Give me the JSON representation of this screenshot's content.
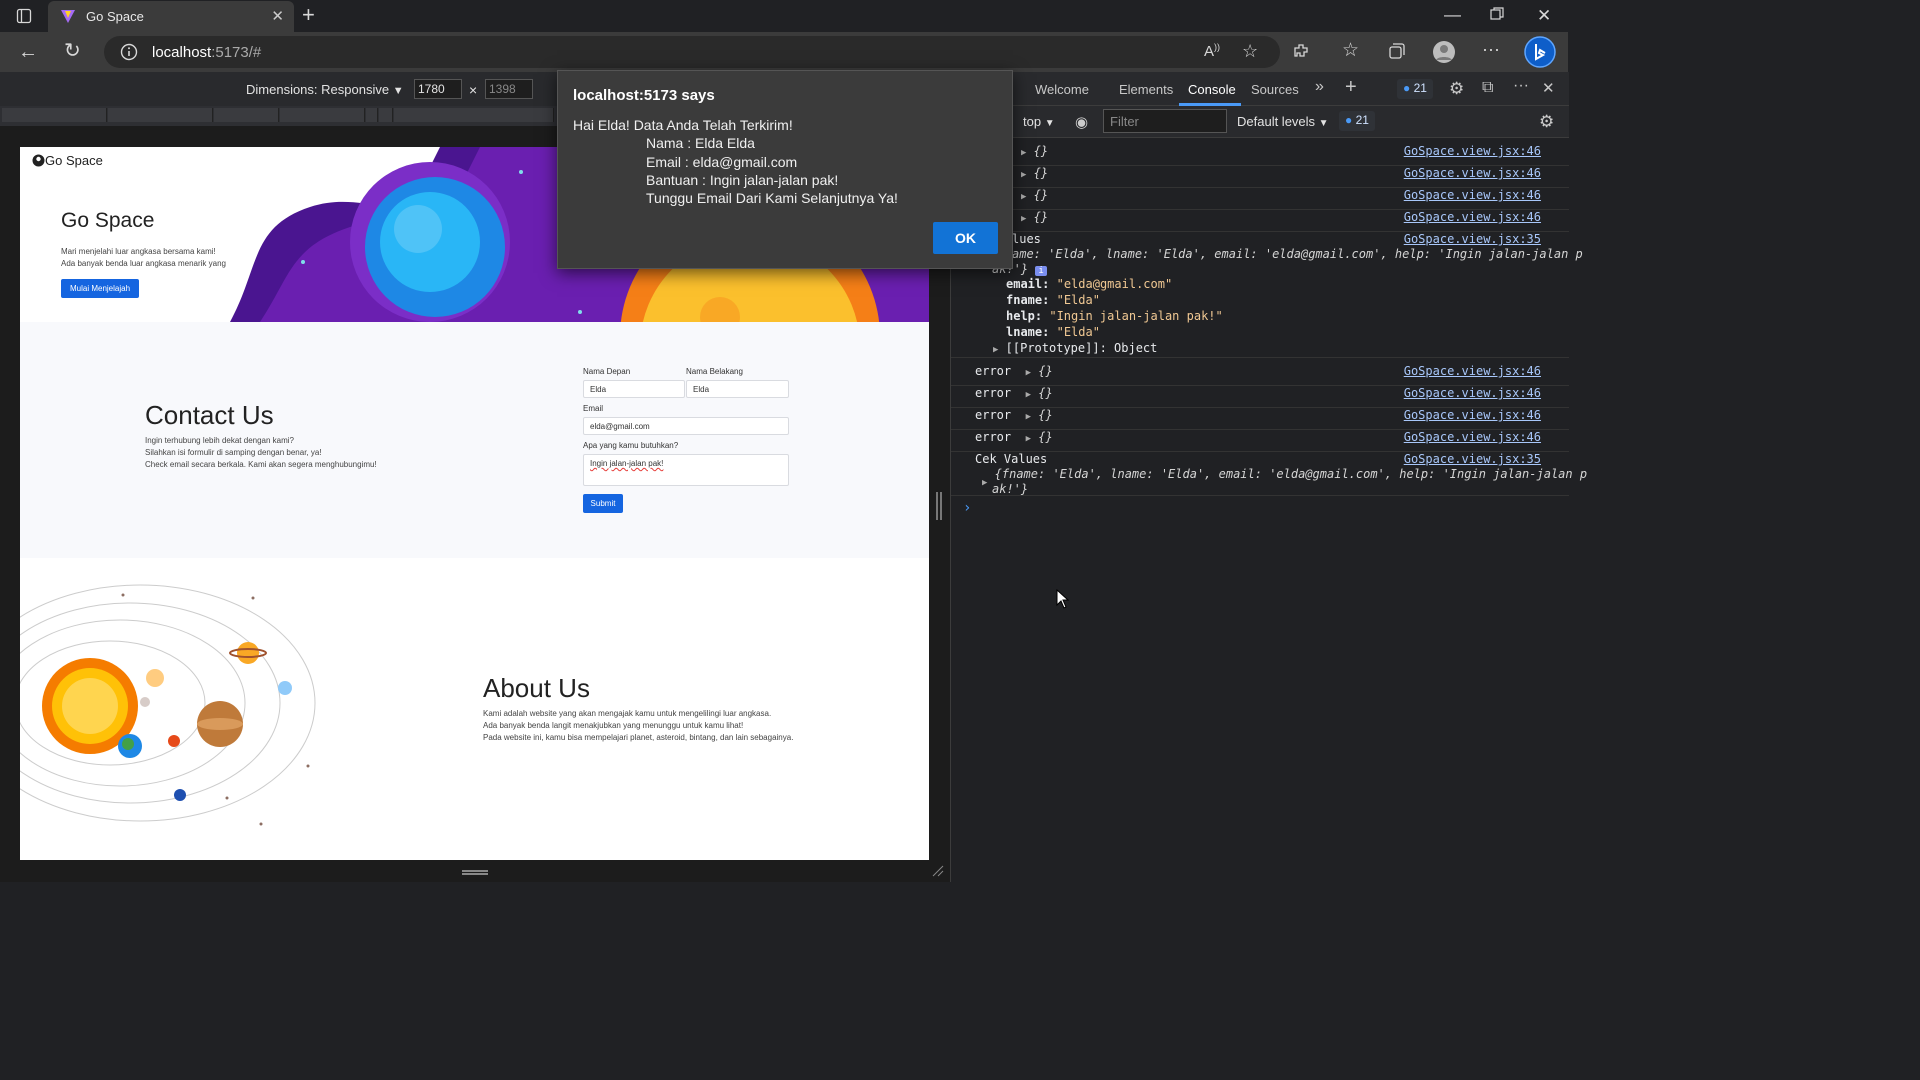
{
  "browser": {
    "tab_title": "Go Space",
    "tab_close": "✕",
    "new_tab": "+",
    "url_host": "localhost",
    "url_rest": ":5173/#"
  },
  "device_toolbar": {
    "dimensions_label": "Dimensions: Responsive",
    "width": "1780",
    "times": "×",
    "height": "1398"
  },
  "site": {
    "brand": "Go Space",
    "hero": {
      "title": "Go Space",
      "desc_line1": "Mari menjelahi luar angkasa bersama kami!",
      "desc_line2": "Ada banyak benda luar angkasa menarik yang",
      "button": "Mulai Menjelajah"
    },
    "contact": {
      "title": "Contact Us",
      "desc_line1": "Ingin terhubung lebih dekat dengan kami?",
      "desc_line2": "Silahkan isi formulir di samping dengan benar, ya!",
      "desc_line3": "Check email secara berkala. Kami akan segera menghubungimu!",
      "first_name_label": "Nama Depan",
      "first_name_value": "Elda",
      "last_name_label": "Nama Belakang",
      "last_name_value": "Elda",
      "email_label": "Email",
      "email_value": "elda@gmail.com",
      "help_label": "Apa yang kamu butuhkan?",
      "help_value": "Ingin jalan-jalan pak!",
      "submit": "Submit"
    },
    "about": {
      "title": "About Us",
      "desc_line1": "Kami adalah website yang akan mengajak kamu untuk mengelilingi luar angkasa.",
      "desc_line2": "Ada banyak benda langit menakjubkan yang menunggu untuk kamu lihat!",
      "desc_line3": "Pada website ini, kamu bisa mempelajari planet, asteroid, bintang, dan lain sebagainya."
    }
  },
  "alert": {
    "title": "localhost:5173 says",
    "line1": "Hai Elda! Data Anda Telah Terkirim!",
    "line2": "Nama : Elda Elda",
    "line3": "Email : elda@gmail.com",
    "line4": "Bantuan : Ingin jalan-jalan pak!",
    "line5": "Tunggu Email Dari Kami Selanjutnya Ya!",
    "ok": "OK"
  },
  "devtools": {
    "tabs": [
      "Welcome",
      "Elements",
      "Console",
      "Sources"
    ],
    "active_tab": "Console",
    "issues_count": "21",
    "context": "top",
    "filter_placeholder": "Filter",
    "levels": "Default levels",
    "messages_count": "21",
    "console": {
      "empty_obj": "{}",
      "src46": "GoSpace.view.jsx:46",
      "src35": "GoSpace.view.jsx:35",
      "values_label": "lues",
      "values_summary1": "ame: 'Elda', lname: 'Elda', email: 'elda@gmail.com', help: 'Ingin jalan-jalan p",
      "values_summary2": "ak!'}",
      "info_badge": "i",
      "prop_email_key": "email:",
      "prop_email_val": "\"elda@gmail.com\"",
      "prop_fname_key": "fname:",
      "prop_fname_val": "\"Elda\"",
      "prop_help_key": "help:",
      "prop_help_val": "\"Ingin jalan-jalan pak!\"",
      "prop_lname_key": "lname:",
      "prop_lname_val": "\"Elda\"",
      "prototype": "[[Prototype]]: Object",
      "error_label": "error",
      "cek_values": "Cek Values",
      "cek_summary1": "{fname: 'Elda', lname: 'Elda', email: 'elda@gmail.com', help: 'Ingin jalan-jalan p",
      "cek_summary2": "ak!'}",
      "prompt": "›"
    }
  },
  "colors": {
    "accent_blue": "#1565e0",
    "devtools_link": "#a8c7fa",
    "ok_button": "#1273d6"
  }
}
